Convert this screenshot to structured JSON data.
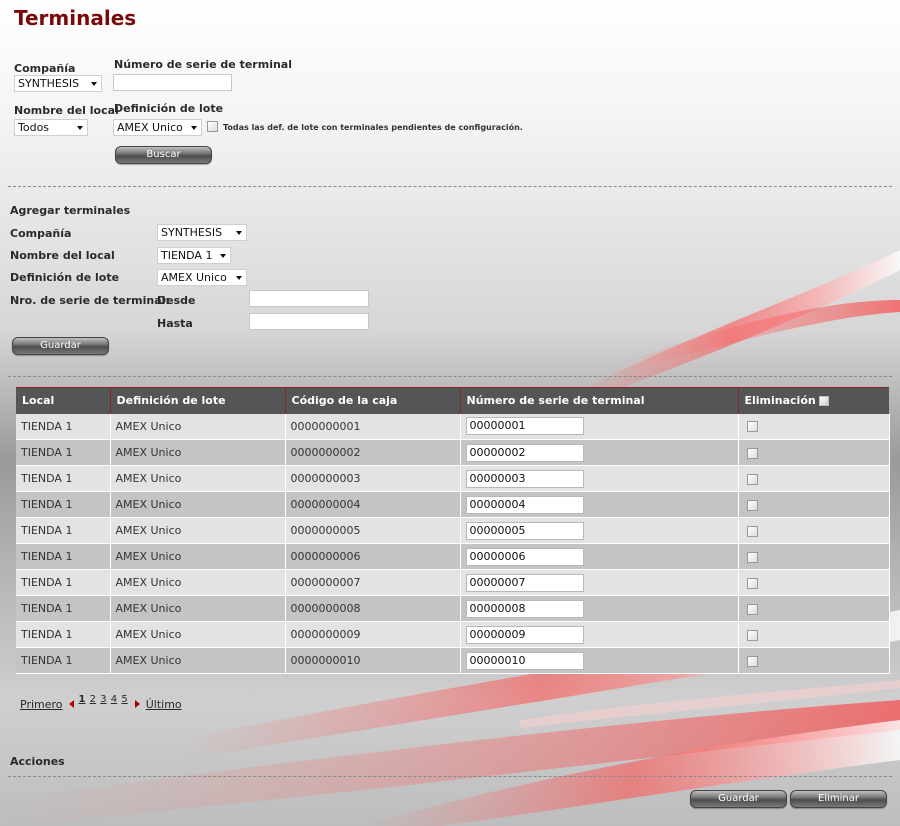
{
  "page_title": "Terminales",
  "search": {
    "company_label": "Compañía",
    "company_value": "SYNTHESIS",
    "serial_label": "Número de serie de terminal",
    "serial_value": "",
    "store_label": "Nombre del local",
    "store_value": "Todos",
    "batch_label": "Definición de lote",
    "batch_value": "AMEX Unico",
    "pending_label": "Todas las def. de lote con terminales pendientes de configuración.",
    "search_button": "Buscar"
  },
  "add": {
    "section_title": "Agregar terminales",
    "company_label": "Compañía",
    "company_value": "SYNTHESIS",
    "store_label": "Nombre del local",
    "store_value": "TIENDA 1",
    "batch_label": "Definición de lote",
    "batch_value": "AMEX Unico",
    "serial_label": "Nro. de serie de terminal:",
    "from_label": "Desde",
    "to_label": "Hasta",
    "save_button": "Guardar"
  },
  "table": {
    "headers": [
      "Local",
      "Definición de lote",
      "Código de la caja",
      "Número de serie de terminal",
      "Eliminación"
    ],
    "rows": [
      {
        "local": "TIENDA 1",
        "lote": "AMEX Unico",
        "caja": "0000000001",
        "serie": "00000001"
      },
      {
        "local": "TIENDA 1",
        "lote": "AMEX Unico",
        "caja": "0000000002",
        "serie": "00000002"
      },
      {
        "local": "TIENDA 1",
        "lote": "AMEX Unico",
        "caja": "0000000003",
        "serie": "00000003"
      },
      {
        "local": "TIENDA 1",
        "lote": "AMEX Unico",
        "caja": "0000000004",
        "serie": "00000004"
      },
      {
        "local": "TIENDA 1",
        "lote": "AMEX Unico",
        "caja": "0000000005",
        "serie": "00000005"
      },
      {
        "local": "TIENDA 1",
        "lote": "AMEX Unico",
        "caja": "0000000006",
        "serie": "00000006"
      },
      {
        "local": "TIENDA 1",
        "lote": "AMEX Unico",
        "caja": "0000000007",
        "serie": "00000007"
      },
      {
        "local": "TIENDA 1",
        "lote": "AMEX Unico",
        "caja": "0000000008",
        "serie": "00000008"
      },
      {
        "local": "TIENDA 1",
        "lote": "AMEX Unico",
        "caja": "0000000009",
        "serie": "00000009"
      },
      {
        "local": "TIENDA 1",
        "lote": "AMEX Unico",
        "caja": "0000000010",
        "serie": "00000010"
      }
    ]
  },
  "pager": {
    "first": "Primero",
    "last": "Último",
    "pages": [
      "1",
      "2",
      "3",
      "4",
      "5"
    ],
    "current": "1"
  },
  "actions": {
    "title": "Acciones",
    "save_button": "Guardar",
    "delete_button": "Eliminar"
  },
  "colors": {
    "title": "#7a0a0a",
    "header_bg": "#555555",
    "header_border": "#8a2525",
    "accent_red": "#b00000"
  }
}
